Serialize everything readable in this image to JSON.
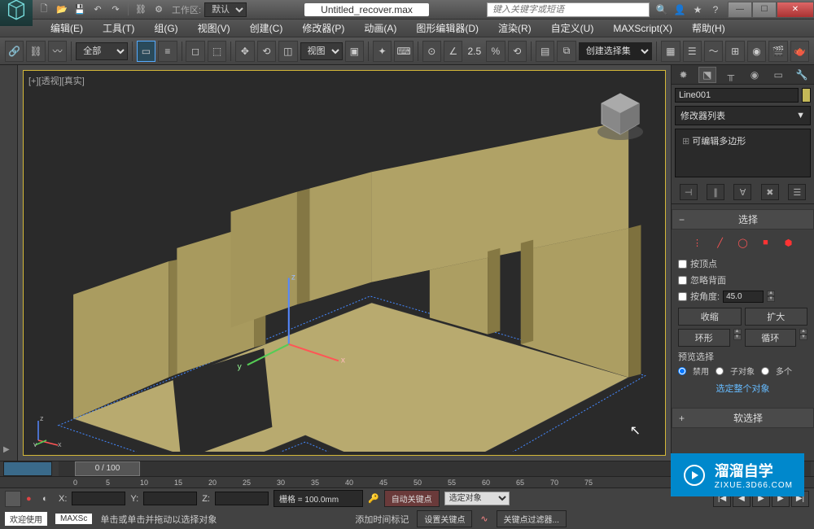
{
  "titlebar": {
    "workspace_label": "工作区:",
    "workspace_value": "默认",
    "filename": "Untitled_recover.max",
    "search_placeholder": "键入关键字或短语"
  },
  "menu": {
    "items": [
      "编辑(E)",
      "工具(T)",
      "组(G)",
      "视图(V)",
      "创建(C)",
      "修改器(P)",
      "动画(A)",
      "图形编辑器(D)",
      "渲染(R)",
      "自定义(U)",
      "MAXScript(X)",
      "帮助(H)"
    ]
  },
  "toolbar": {
    "filter_select": "全部",
    "viewmode": "视图",
    "angle_text": "2.5",
    "selection_set_placeholder": "创建选择集"
  },
  "viewport": {
    "label": "[+][透视][真实]"
  },
  "panel": {
    "object_name": "Line001",
    "modifier_list_label": "修改器列表",
    "stack_item": "可编辑多边形",
    "rollout_select": "选择",
    "by_vertex": "按顶点",
    "ignore_backface": "忽略背面",
    "by_angle": "按角度:",
    "angle_value": "45.0",
    "shrink": "收缩",
    "grow": "扩大",
    "ring": "环形",
    "loop": "循环",
    "preview_label": "预览选择",
    "preview_off": "禁用",
    "preview_subobj": "子对象",
    "preview_multi": "多个",
    "select_whole": "选定整个对象",
    "soft_select": "软选择"
  },
  "timeline": {
    "frame_display": "0 / 100",
    "ticks": [
      "0",
      "5",
      "10",
      "15",
      "20",
      "25",
      "30",
      "35",
      "40",
      "45",
      "50",
      "55",
      "60",
      "65",
      "70",
      "75"
    ]
  },
  "status": {
    "x_label": "X:",
    "y_label": "Y:",
    "z_label": "Z:",
    "grid": "栅格 = 100.0mm",
    "auto_key": "自动关键点",
    "set_key": "设置关键点",
    "selected_obj": "选定对象",
    "key_filter": "关键点过滤器...",
    "welcome": "欢迎使用",
    "maxsc": "MAXSc",
    "hint1": "单击或单击并拖动以选择对象",
    "hint2": "添加时间标记"
  },
  "watermark": {
    "main": "溜溜自学",
    "sub": "ZIXUE.3D66.COM"
  }
}
